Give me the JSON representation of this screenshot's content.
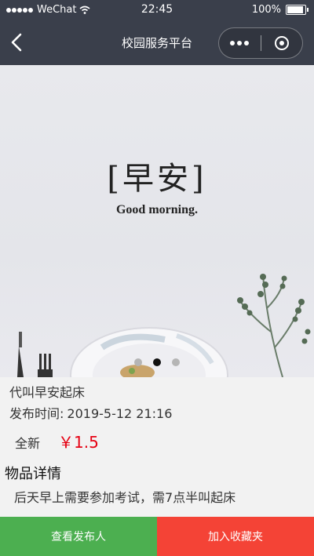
{
  "status_bar": {
    "carrier": "WeChat",
    "time": "22:45",
    "battery": "100%"
  },
  "nav": {
    "title": "校园服务平台"
  },
  "banner": {
    "title_cn": "[早安]",
    "title_en": "Good morning.",
    "dots": 3,
    "active_dot": 2
  },
  "item": {
    "title": "代叫早安起床",
    "publish_label": "发布时间:",
    "publish_time": "2019-5-12 21:16",
    "condition": "全新",
    "price": "￥1.5",
    "detail_heading": "物品详情",
    "detail_text": "后天早上需要参加考试，需7点半叫起床"
  },
  "actions": {
    "view_publisher": "查看发布人",
    "add_favorite": "加入收藏夹"
  },
  "colors": {
    "nav": "#3a3f4b",
    "green": "#4caf50",
    "red": "#f44336",
    "price": "#e60012"
  }
}
